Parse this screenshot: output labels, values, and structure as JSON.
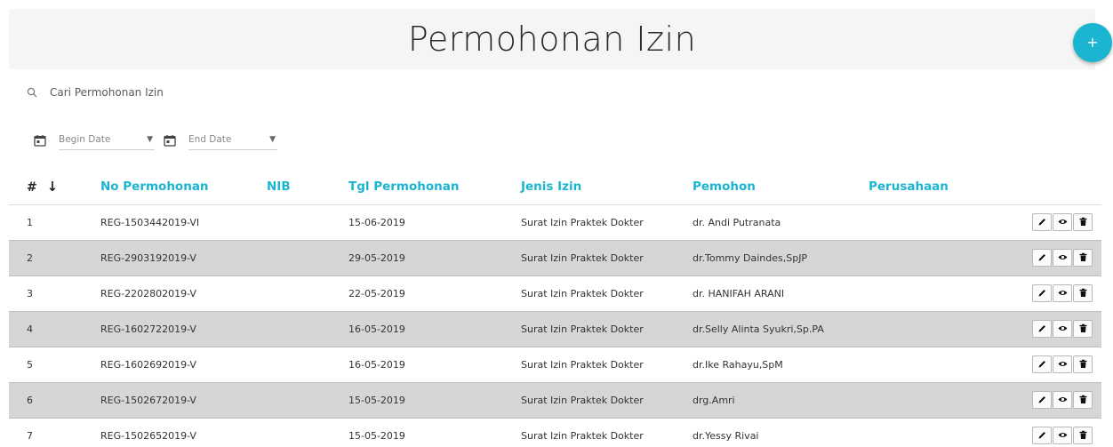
{
  "header": {
    "title": "Permohonan Izin",
    "add_button_label": "+"
  },
  "search": {
    "placeholder": "Cari Permohonan Izin"
  },
  "filters": {
    "begin_date_placeholder": "Begin Date",
    "end_date_placeholder": "End Date"
  },
  "table": {
    "columns": [
      "#",
      "No Permohonan",
      "NIB",
      "Tgl Permohonan",
      "Jenis Izin",
      "Pemohon",
      "Perusahaan"
    ],
    "sort_indicator": "↓",
    "rows": [
      {
        "no": "1",
        "no_permohonan": "REG-1503442019-VI",
        "nib": "",
        "tgl": "15-06-2019",
        "jenis": "Surat Izin Praktek Dokter",
        "pemohon": "dr. Andi Putranata",
        "perusahaan": ""
      },
      {
        "no": "2",
        "no_permohonan": "REG-2903192019-V",
        "nib": "",
        "tgl": "29-05-2019",
        "jenis": "Surat Izin Praktek Dokter",
        "pemohon": "dr.Tommy Daindes,SpJP",
        "perusahaan": ""
      },
      {
        "no": "3",
        "no_permohonan": "REG-2202802019-V",
        "nib": "",
        "tgl": "22-05-2019",
        "jenis": "Surat Izin Praktek Dokter",
        "pemohon": "dr. HANIFAH ARANI",
        "perusahaan": ""
      },
      {
        "no": "4",
        "no_permohonan": "REG-1602722019-V",
        "nib": "",
        "tgl": "16-05-2019",
        "jenis": "Surat Izin Praktek Dokter",
        "pemohon": "dr.Selly Alinta Syukri,Sp.PA",
        "perusahaan": ""
      },
      {
        "no": "5",
        "no_permohonan": "REG-1602692019-V",
        "nib": "",
        "tgl": "16-05-2019",
        "jenis": "Surat Izin Praktek Dokter",
        "pemohon": "dr.Ike Rahayu,SpM",
        "perusahaan": ""
      },
      {
        "no": "6",
        "no_permohonan": "REG-1502672019-V",
        "nib": "",
        "tgl": "15-05-2019",
        "jenis": "Surat Izin Praktek Dokter",
        "pemohon": "drg.Amri",
        "perusahaan": ""
      },
      {
        "no": "7",
        "no_permohonan": "REG-1502652019-V",
        "nib": "",
        "tgl": "15-05-2019",
        "jenis": "Surat Izin Praktek Dokter",
        "pemohon": "dr.Yessy Rivai",
        "perusahaan": ""
      }
    ],
    "row_actions": [
      "pencil-icon",
      "eye-icon",
      "trash-icon"
    ]
  },
  "colors": {
    "accent": "#1cb5d1",
    "header_band": "#f5f5f5",
    "row_shade": "#d6d6d6"
  }
}
